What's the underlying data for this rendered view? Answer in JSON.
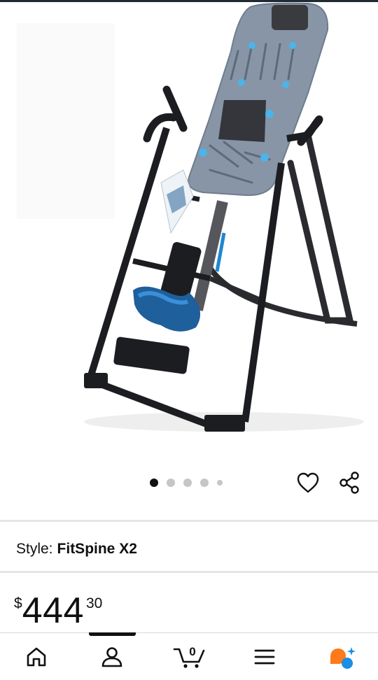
{
  "product": {
    "image_alt": "Inversion table",
    "carousel": {
      "total": 5,
      "active_index": 0
    }
  },
  "style": {
    "label": "Style:",
    "value": "FitSpine X2"
  },
  "price": {
    "symbol": "$",
    "whole": "444",
    "fraction": "30"
  },
  "nav": {
    "cart_count": "0",
    "items": [
      "home-icon",
      "account-icon",
      "cart-icon",
      "menu-icon",
      "rufus-icon"
    ]
  },
  "colors": {
    "accent_blue": "#1f88d0",
    "rufus_orange": "#ff7a1a",
    "rufus_blue": "#1a8fe3",
    "frame": "#1c1d20",
    "board": "#8795a6"
  }
}
